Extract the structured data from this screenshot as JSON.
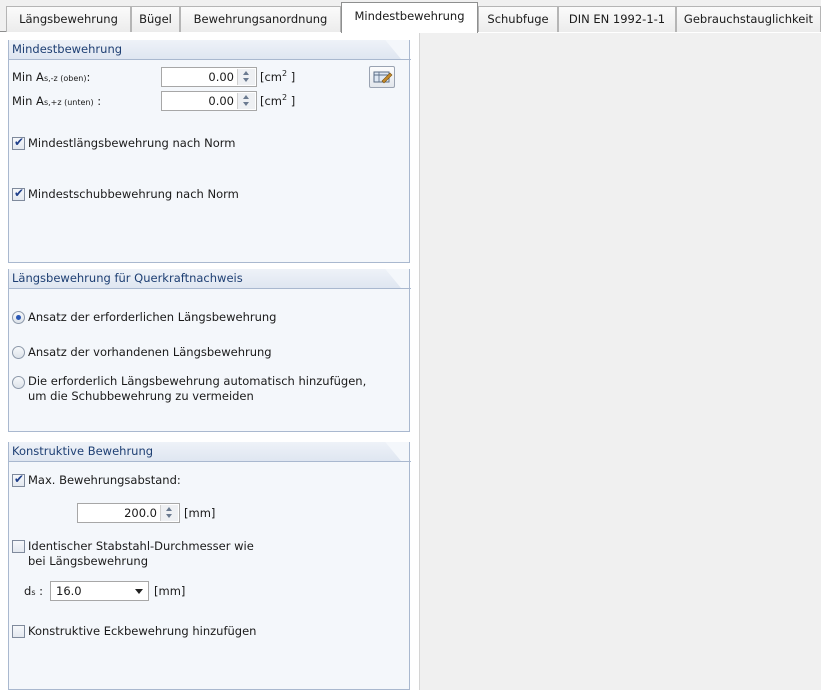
{
  "tabs": [
    {
      "label": "Längsbewehrung",
      "active": false
    },
    {
      "label": "Bügel",
      "active": false
    },
    {
      "label": "Bewehrungsanordnung",
      "active": false
    },
    {
      "label": "Mindestbewehrung",
      "active": true
    },
    {
      "label": "Schubfuge",
      "active": false
    },
    {
      "label": "DIN EN 1992-1-1",
      "active": false
    },
    {
      "label": "Gebrauchstauglichkeit",
      "active": false
    }
  ],
  "mindest": {
    "title": "Mindestbewehrung",
    "row1": {
      "label_pre": "Min A",
      "label_sub": "s,-z (oben)",
      "label_post": ":",
      "value": "0.00",
      "unit_pre": "[cm",
      "unit_sup": "2",
      "unit_post": " ]"
    },
    "row2": {
      "label_pre": "Min A",
      "label_sub": "s,+z (unten)",
      "label_post": " :",
      "value": "0.00",
      "unit_pre": "[cm",
      "unit_sup": "2",
      "unit_post": " ]"
    },
    "check_laengs": {
      "label": "Mindestlängsbewehrung nach Norm",
      "checked": true
    },
    "check_schub": {
      "label": "Mindestschubbewehrung nach Norm",
      "checked": true
    },
    "icon": "edit-table-icon"
  },
  "querkraft": {
    "title": "Längsbewehrung für Querkraftnachweis",
    "options": [
      {
        "label": "Ansatz der erforderlichen Längsbewehrung",
        "checked": true
      },
      {
        "label": "Ansatz der vorhandenen Längsbewehrung",
        "checked": false
      },
      {
        "label_line1": "Die erforderlich Längsbewehrung automatisch hinzufügen,",
        "label_line2": "um die Schubbewehrung zu vermeiden",
        "checked": false
      }
    ]
  },
  "konstruktiv": {
    "title": "Konstruktive Bewehrung",
    "max_abstand": {
      "label": "Max. Bewehrungsabstand:",
      "checked": true,
      "value": "200.0",
      "unit": "[mm]"
    },
    "identisch": {
      "label_line1": "Identischer Stabstahl-Durchmesser wie",
      "label_line2": "bei Längsbewehrung",
      "checked": false
    },
    "ds": {
      "label_pre": "d",
      "label_sub": "s",
      "label_post": " :",
      "value": "16.0",
      "unit": "[mm]"
    },
    "eck": {
      "label": "Konstruktive Eckbewehrung hinzufügen",
      "checked": false
    }
  }
}
